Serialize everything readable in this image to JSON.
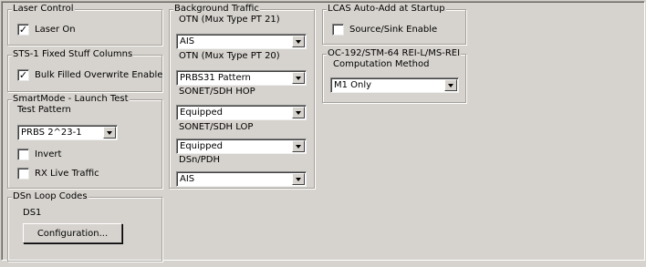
{
  "laser_control": {
    "legend": "Laser Control",
    "laser_on": {
      "label": "Laser On",
      "checked": true
    }
  },
  "sts1": {
    "legend": "STS-1 Fixed Stuff Columns",
    "bulk_filled": {
      "label": "Bulk Filled Overwrite Enable",
      "checked": true
    }
  },
  "smartmode": {
    "legend": "SmartMode  - Launch Test",
    "test_pattern_label": "Test Pattern",
    "test_pattern_value": "PRBS 2^23-1",
    "invert": {
      "label": "Invert",
      "checked": false
    },
    "rx_live": {
      "label": "RX Live Traffic",
      "checked": false
    }
  },
  "dsn_loop": {
    "legend": "DSn Loop Codes",
    "ds1_label": "DS1",
    "config_button": "Configuration..."
  },
  "background_traffic": {
    "legend": "Background Traffic",
    "otn21_label": "OTN (Mux Type PT 21)",
    "otn21_value": "AIS",
    "otn20_label": "OTN (Mux Type PT 20)",
    "otn20_value": "PRBS31 Pattern",
    "hop_label": "SONET/SDH HOP",
    "hop_value": "Equipped",
    "lop_label": "SONET/SDH LOP",
    "lop_value": "Equipped",
    "dsn_label": "DSn/PDH",
    "dsn_value": "AIS"
  },
  "lcas": {
    "legend": "LCAS Auto-Add at Startup",
    "source_sink": {
      "label": "Source/Sink Enable",
      "checked": false
    }
  },
  "oc192": {
    "legend": "OC-192/STM-64 REI-L/MS-REI",
    "computation_label": "Computation Method",
    "computation_value": "M1 Only"
  },
  "check_glyph": "✓"
}
